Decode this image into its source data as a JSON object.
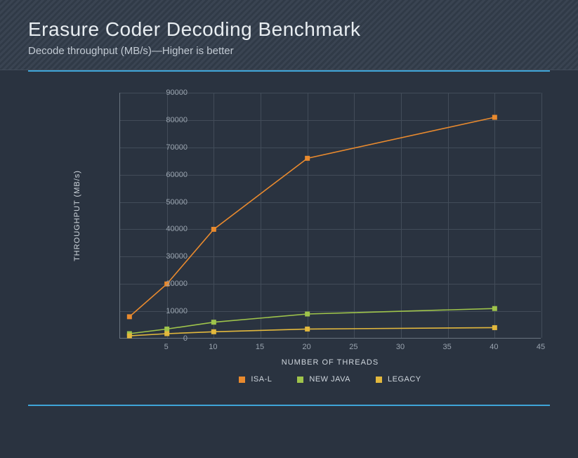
{
  "header": {
    "title": "Erasure Coder Decoding Benchmark",
    "subtitle": "Decode throughput (MB/s)—Higher is better"
  },
  "chart_data": {
    "type": "line",
    "title": "Erasure Coder Decoding Benchmark",
    "xlabel": "NUMBER OF THREADS",
    "ylabel": "THROUGHPUT (MB/s)",
    "xlim": [
      0,
      45
    ],
    "ylim": [
      0,
      90000
    ],
    "x_ticks": [
      5,
      10,
      15,
      20,
      25,
      30,
      35,
      40,
      45
    ],
    "y_ticks": [
      0,
      10000,
      20000,
      30000,
      40000,
      50000,
      60000,
      70000,
      80000,
      90000
    ],
    "x": [
      1,
      5,
      10,
      20,
      40
    ],
    "series": [
      {
        "name": "ISA-L",
        "color": "#e98a2e",
        "values": [
          8000,
          20000,
          40000,
          66000,
          81000
        ]
      },
      {
        "name": "NEW JAVA",
        "color": "#9fc44b",
        "values": [
          1800,
          3500,
          6000,
          9000,
          11000
        ]
      },
      {
        "name": "LEGACY",
        "color": "#e2b83d",
        "values": [
          1000,
          1800,
          2500,
          3500,
          4000
        ]
      }
    ],
    "legend_position": "bottom",
    "grid": true
  }
}
